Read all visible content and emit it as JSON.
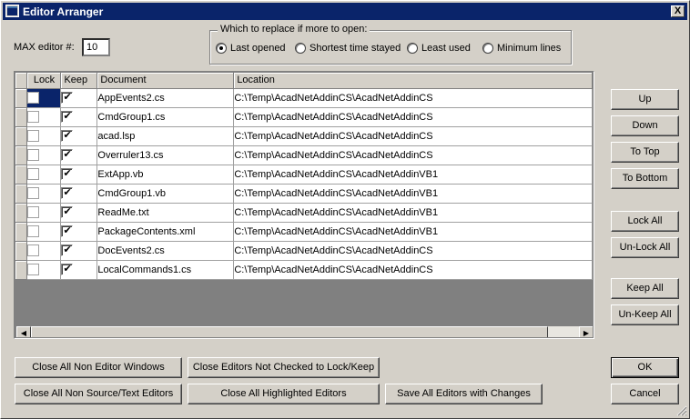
{
  "window": {
    "title": "Editor Arranger",
    "close_label": "X"
  },
  "max_editor": {
    "label": "MAX editor #:",
    "value": "10"
  },
  "replace_group": {
    "title": "Which to replace if more to open:",
    "options": [
      {
        "label": "Last opened",
        "selected": true
      },
      {
        "label": "Shortest time stayed",
        "selected": false
      },
      {
        "label": "Least used",
        "selected": false
      },
      {
        "label": "Minimum lines",
        "selected": false
      }
    ]
  },
  "grid": {
    "columns": [
      "Lock",
      "Keep",
      "Document",
      "Location"
    ],
    "rows": [
      {
        "lock": false,
        "keep": true,
        "document": "AppEvents2.cs",
        "location": "C:\\Temp\\AcadNetAddinCS\\AcadNetAddinCS"
      },
      {
        "lock": false,
        "keep": true,
        "document": "CmdGroup1.cs",
        "location": "C:\\Temp\\AcadNetAddinCS\\AcadNetAddinCS"
      },
      {
        "lock": false,
        "keep": true,
        "document": "acad.lsp",
        "location": "C:\\Temp\\AcadNetAddinCS\\AcadNetAddinCS"
      },
      {
        "lock": false,
        "keep": true,
        "document": "Overruler13.cs",
        "location": "C:\\Temp\\AcadNetAddinCS\\AcadNetAddinCS"
      },
      {
        "lock": false,
        "keep": true,
        "document": "ExtApp.vb",
        "location": "C:\\Temp\\AcadNetAddinCS\\AcadNetAddinVB1"
      },
      {
        "lock": false,
        "keep": true,
        "document": "CmdGroup1.vb",
        "location": "C:\\Temp\\AcadNetAddinCS\\AcadNetAddinVB1"
      },
      {
        "lock": false,
        "keep": true,
        "document": "ReadMe.txt",
        "location": "C:\\Temp\\AcadNetAddinCS\\AcadNetAddinVB1"
      },
      {
        "lock": false,
        "keep": true,
        "document": "PackageContents.xml",
        "location": "C:\\Temp\\AcadNetAddinCS\\AcadNetAddinVB1"
      },
      {
        "lock": false,
        "keep": true,
        "document": "DocEvents2.cs",
        "location": "C:\\Temp\\AcadNetAddinCS\\AcadNetAddinCS"
      },
      {
        "lock": false,
        "keep": true,
        "document": "LocalCommands1.cs",
        "location": "C:\\Temp\\AcadNetAddinCS\\AcadNetAddinCS"
      }
    ]
  },
  "side_buttons": {
    "up": "Up",
    "down": "Down",
    "to_top": "To Top",
    "to_bottom": "To Bottom",
    "lock_all": "Lock All",
    "unlock_all": "Un-Lock All",
    "keep_all": "Keep All",
    "unkeep_all": "Un-Keep All"
  },
  "bottom_buttons": {
    "close_non_editor": "Close All Non Editor Windows",
    "close_not_checked": "Close Editors Not Checked to Lock/Keep",
    "close_non_source": "Close All Non Source/Text Editors",
    "close_highlighted": "Close All Highlighted Editors",
    "save_all": "Save All Editors with Changes"
  },
  "dialog_buttons": {
    "ok": "OK",
    "cancel": "Cancel"
  }
}
